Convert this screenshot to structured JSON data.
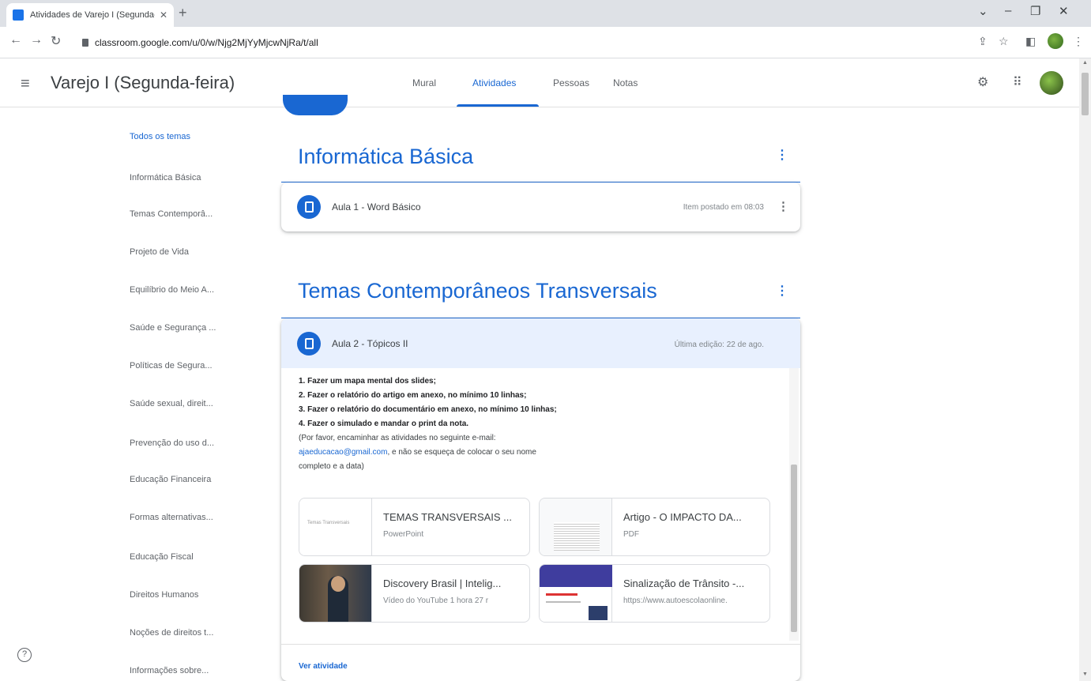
{
  "browser": {
    "tab_title": "Atividades de Varejo I (Segunda-",
    "url": "classroom.google.com/u/0/w/Njg2MjYyMjcwNjRa/t/all"
  },
  "app": {
    "course_title": "Varejo I (Segunda-feira)",
    "tabs": [
      "Mural",
      "Atividades",
      "Pessoas",
      "Notas"
    ],
    "active_tab": "Atividades"
  },
  "sidebar": {
    "topics": [
      "Todos os temas",
      "Informática Básica",
      "Temas Contemporâ...",
      "Projeto de Vida",
      "Equilíbrio do Meio A...",
      "Saúde e Segurança ...",
      "Políticas de Segura...",
      "Saúde sexual, direit...",
      "Prevenção do uso d...",
      "Educação Financeira",
      "Formas alternativas...",
      "Educação Fiscal",
      "Direitos Humanos",
      "Noções de direitos t...",
      "Informações sobre..."
    ]
  },
  "sections": [
    {
      "title": "Informática Básica",
      "items": [
        {
          "title": "Aula 1 - Word Básico",
          "meta": "Item postado em 08:03"
        }
      ]
    },
    {
      "title": "Temas Contemporâneos Transversais",
      "items": [
        {
          "title": "Aula 2 - Tópicos II",
          "meta": "Última edição: 22 de ago."
        }
      ]
    }
  ],
  "expanded": {
    "lines": [
      "1. Fazer um mapa mental dos slides;",
      "2. Fazer o relatório do artigo em anexo, no mínimo 10 linhas;",
      "3. Fazer o relatório do documentário em anexo, no mínimo 10 linhas;",
      "4. Fazer o simulado e mandar o print da nota."
    ],
    "note_1": "(Por favor, encaminhar as atividades no seguinte e-mail:",
    "email": "ajaeducacao@gmail.com",
    "note_2": ", e não se esqueça de colocar o seu nome",
    "note_3": "completo e a data)",
    "attachments": [
      {
        "title": "TEMAS TRANSVERSAIS ...",
        "subtitle": "PowerPoint",
        "thumb_label": "Temas Transversais"
      },
      {
        "title": "Artigo - O IMPACTO DA...",
        "subtitle": "PDF"
      },
      {
        "title": "Discovery Brasil | Intelig...",
        "subtitle": "Vídeo do YouTube   1 hora 27 r"
      },
      {
        "title": "Sinalização de Trânsito -...",
        "subtitle": "https://www.autoescolaonline."
      }
    ],
    "view_link": "Ver atividade"
  },
  "colors": {
    "accent": "#1967d2",
    "expanded_header": "#e8f0fe"
  }
}
